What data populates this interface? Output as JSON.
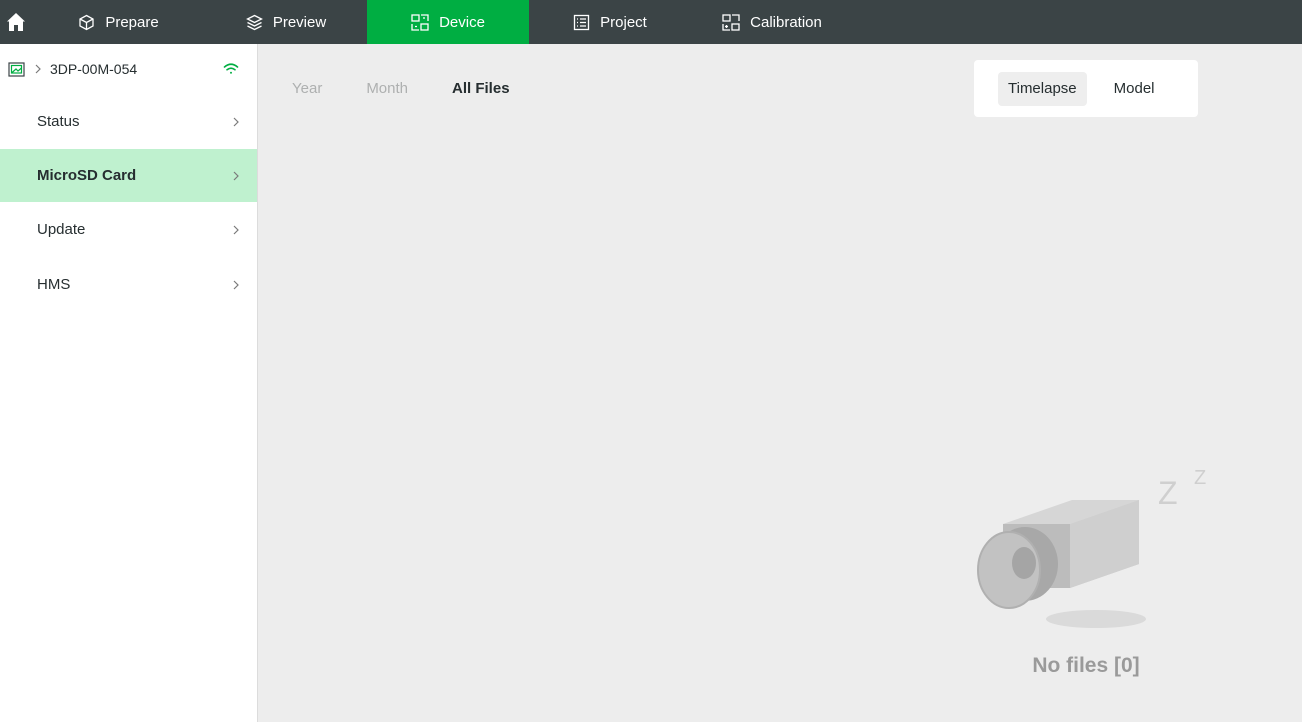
{
  "nav": {
    "tabs": [
      {
        "label": "Prepare",
        "icon": "cube-icon",
        "active": false
      },
      {
        "label": "Preview",
        "icon": "layers-icon",
        "active": false
      },
      {
        "label": "Device",
        "icon": "device-icon",
        "active": true
      },
      {
        "label": "Project",
        "icon": "project-icon",
        "active": false
      },
      {
        "label": "Calibration",
        "icon": "calibration-icon",
        "active": false
      }
    ],
    "active_color": "#00ae42"
  },
  "sidebar": {
    "printer_name": "3DP-00M-054",
    "items": [
      {
        "label": "Status",
        "active": false
      },
      {
        "label": "MicroSD Card",
        "active": true
      },
      {
        "label": "Update",
        "active": false
      },
      {
        "label": "HMS",
        "active": false
      }
    ]
  },
  "main": {
    "filters": [
      {
        "label": "Year",
        "active": false
      },
      {
        "label": "Month",
        "active": false
      },
      {
        "label": "All Files",
        "active": true
      }
    ],
    "toggle": [
      {
        "label": "Timelapse",
        "active": true
      },
      {
        "label": "Model",
        "active": false
      }
    ],
    "empty_text": "No files [0]",
    "empty_icon": "sleeping-camera-icon"
  }
}
